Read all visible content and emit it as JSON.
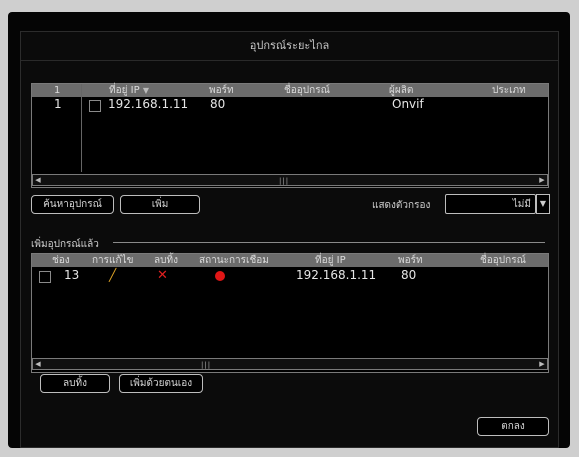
{
  "dialog": {
    "title": "อุปกรณ์ระยะไกล"
  },
  "device_search": {
    "columns": {
      "index": "1",
      "ip": "ที่อยู่ IP",
      "port": "พอร์ท",
      "name": "ชื่ออุปกรณ์",
      "maker": "ผู้ผลิต",
      "type": "ประเภท"
    },
    "sort_icon": "triangle-down-icon",
    "rows": [
      {
        "index": "1",
        "ip": "192.168.1.11",
        "port": "80",
        "name": "",
        "maker": "Onvif",
        "type": ""
      }
    ],
    "search_button": "ค้นหาอุปกรณ์",
    "add_button": "เพิ่ม",
    "filter_label": "แสดงตัวกรอง",
    "filter_value": "ไม่มี"
  },
  "added_devices": {
    "section_title": "เพิ่มอุปกรณ์แล้ว",
    "columns": {
      "channel": "ช่อง",
      "edit": "การแก้ไข",
      "delete": "ลบทิ้ง",
      "status": "สถานะการเชื่อม",
      "ip": "ที่อยู่ IP",
      "port": "พอร์ท",
      "name": "ชื่ออุปกรณ์"
    },
    "rows": [
      {
        "channel": "13",
        "ip": "192.168.1.11",
        "port": "80",
        "status_color": "#e01616"
      }
    ],
    "delete_button": "ลบทิ้ง",
    "manual_add_button": "เพิ่มด้วยตนเอง"
  },
  "ok_button": "ตกลง",
  "colors": {
    "edit_icon": "#e0a526",
    "delete_icon": "#e02020",
    "status_dot": "#e01616",
    "header_bg": "#6c6c6c"
  }
}
